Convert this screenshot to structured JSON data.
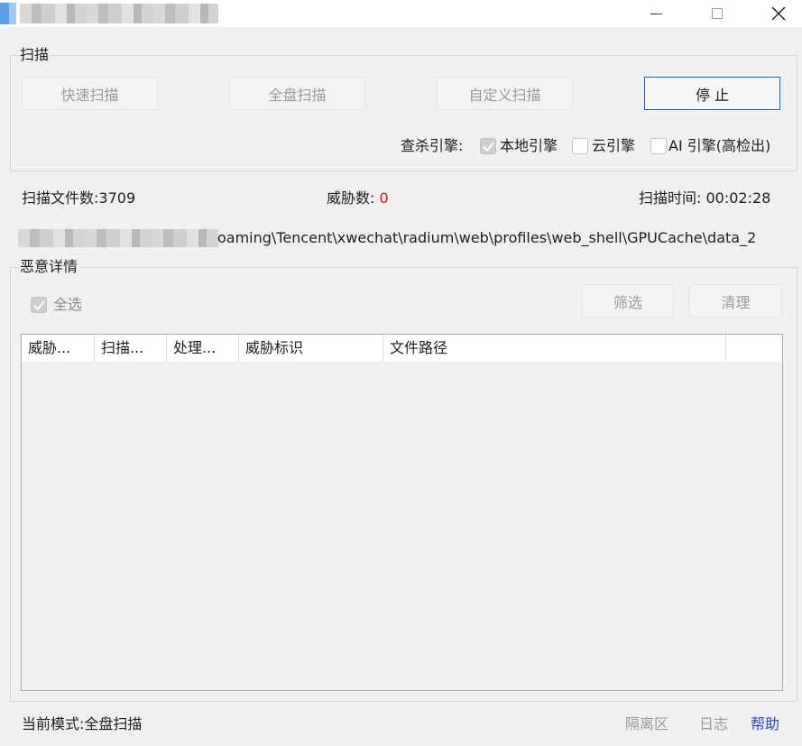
{
  "window": {
    "title_obscured": true,
    "close_glyph": "✕"
  },
  "scan_group": {
    "title": "扫描",
    "quick_scan": "快速扫描",
    "full_scan": "全盘扫描",
    "custom_scan": "自定义扫描",
    "stop": "停 止",
    "engine_label": "查杀引擎:",
    "engines": [
      {
        "label": "本地引擎",
        "checked": true
      },
      {
        "label": "云引擎",
        "checked": false
      },
      {
        "label": "AI 引擎(高检出)",
        "checked": false
      }
    ]
  },
  "stats": {
    "files_label": "扫描文件数:",
    "files_value": "3709",
    "threats_label": "威胁数:",
    "threats_value": "0",
    "time_label": "扫描时间:",
    "time_value": "00:02:28"
  },
  "current_path": "oaming\\Tencent\\xwechat\\radium\\web\\profiles\\web_shell\\GPUCache\\data_2",
  "details_group": {
    "title": "恶意详情",
    "select_all": "全选",
    "filter": "筛选",
    "clean": "清理",
    "columns": [
      "威胁...",
      "扫描...",
      "处理...",
      "威胁标识",
      "文件路径",
      ""
    ]
  },
  "footer": {
    "mode": "当前模式:全盘扫描",
    "quarantine": "隔离区",
    "log": "日志",
    "help": "帮助"
  },
  "colors": {
    "accent": "#0a63c9",
    "threat_count": "#e01010",
    "help_link": "#2b44d8"
  }
}
